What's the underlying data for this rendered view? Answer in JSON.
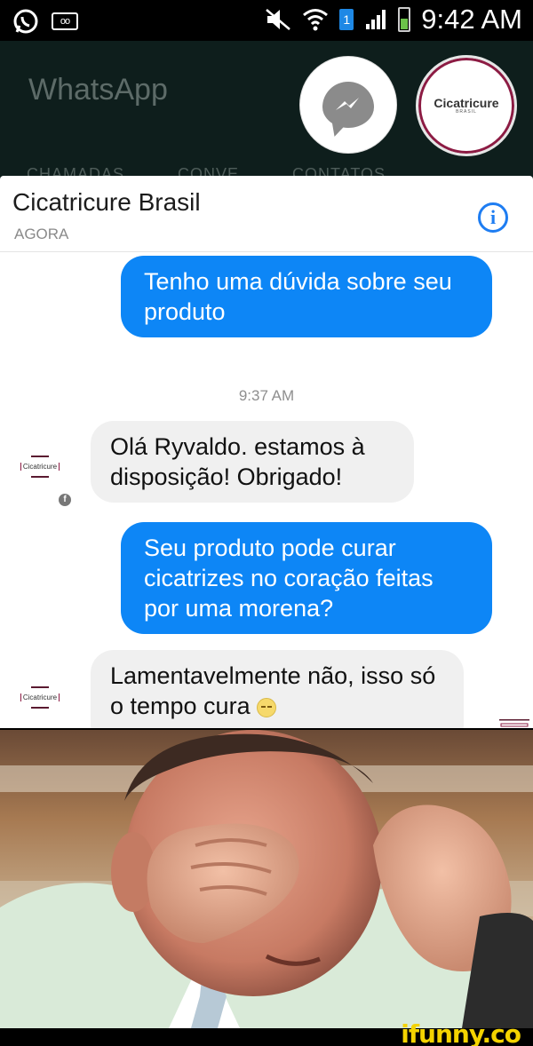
{
  "status_bar": {
    "time": "9:42 AM",
    "sim": "1",
    "voicemail": "oo"
  },
  "background_app": {
    "title": "WhatsApp",
    "tabs": [
      "CHAMADAS",
      "CONVE",
      "CONTATOS"
    ]
  },
  "chat_heads": {
    "brand_top": "Cicatricure",
    "brand_sub": "BRASIL"
  },
  "chat": {
    "name": "Cicatricure Brasil",
    "subtitle": "AGORA",
    "messages": [
      {
        "from": "me",
        "text": "Tenho uma dúvida sobre seu produto"
      },
      {
        "timestamp": "9:37 AM"
      },
      {
        "from": "page",
        "text": "Olá Ryvaldo. estamos à disposição! Obrigado!"
      },
      {
        "from": "me",
        "text": "Seu produto pode curar cicatrizes no coração feitas por uma morena?"
      },
      {
        "from": "page",
        "text": "Lamentavelmente não, isso só o tempo cura"
      }
    ],
    "avatar_label": "Cicatricure"
  },
  "watermark": "ifunny.co",
  "colors": {
    "accent": "#0d86f6",
    "brand": "#8c1b43",
    "watermark": "#f4d300"
  }
}
